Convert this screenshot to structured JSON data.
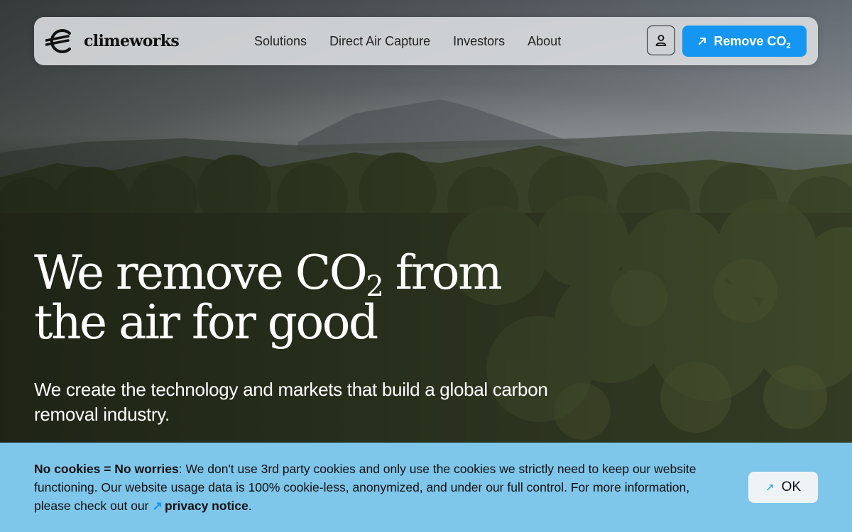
{
  "brand": {
    "name": "climeworks"
  },
  "nav": {
    "links": [
      "Solutions",
      "Direct Air Capture",
      "Investors",
      "About"
    ],
    "account_icon": "user-icon",
    "cta": {
      "label": "Remove CO",
      "sub": "2",
      "icon": "arrow-up-right-icon"
    }
  },
  "hero": {
    "title_line1_a": "We remove CO",
    "title_line1_sub": "2",
    "title_line1_b": " from",
    "title_line2": "the air for good",
    "subtitle": "We create the technology and markets that build a global carbon removal industry."
  },
  "cookie": {
    "heading": "No cookies = No worries",
    "body": ": We don't use 3rd party cookies and only use the cookies we strictly need to keep our website functioning. Our website usage data is 100% cookie-less, anonymized, and under our full control. For more information, please check out our ",
    "link_label": "privacy notice",
    "end": ".",
    "ok_label": "OK"
  },
  "colors": {
    "accent": "#1496f2",
    "banner": "#7ec6ea",
    "nav_bg": "#dee0e2"
  }
}
